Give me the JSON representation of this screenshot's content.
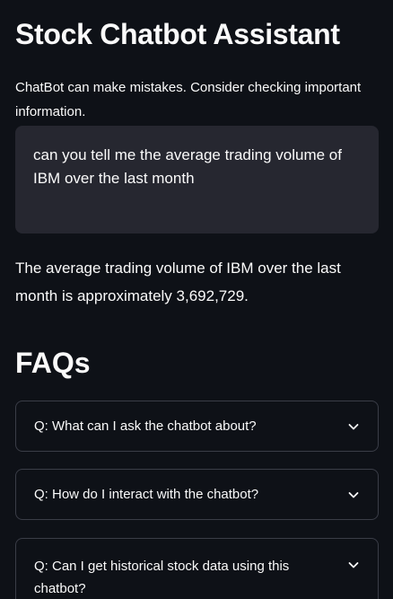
{
  "header": {
    "title": "Stock Chatbot Assistant"
  },
  "disclaimer": "ChatBot can make mistakes. Consider checking important information.",
  "chat": {
    "user_query": "can you tell me the average trading volume of IBM over the last month",
    "assistant_answer": "The average trading volume of IBM over the last month is approximately 3,692,729."
  },
  "faq": {
    "heading": "FAQs",
    "items": [
      {
        "question": "Q: What can I ask the chatbot about?",
        "icon": "chevron-down-icon"
      },
      {
        "question": "Q: How do I interact with the chatbot?",
        "icon": "chevron-down-icon"
      },
      {
        "question": "Q: Can I get historical stock data using this chatbot?",
        "icon": "chevron-down-icon"
      }
    ]
  },
  "colors": {
    "background": "#0e1117",
    "text": "#fafafa",
    "query_bubble": "#262730",
    "faq_border": "#3a3d47"
  }
}
